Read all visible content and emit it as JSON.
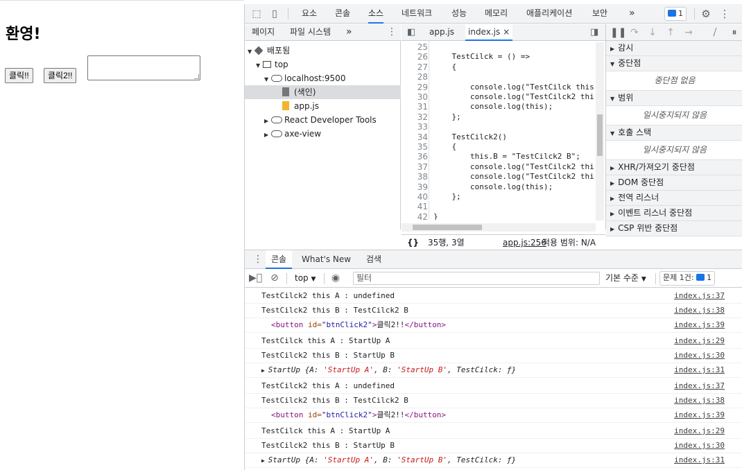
{
  "page": {
    "heading": "환영!",
    "button1": "클릭!!",
    "button2": "클릭2!!"
  },
  "devtools": {
    "main_tabs": [
      "요소",
      "콘솔",
      "소스",
      "네트워크",
      "성능",
      "메모리",
      "애플리케이션",
      "보안"
    ],
    "more_tabs": "»",
    "issue_count": "1",
    "navigator": {
      "tabs": [
        "페이지",
        "파일 시스템"
      ],
      "more": "»",
      "tree": [
        {
          "label": "배포됨"
        },
        {
          "label": "top"
        },
        {
          "label": "localhost:9500"
        },
        {
          "label": "(색인)"
        },
        {
          "label": "app.js"
        },
        {
          "label": "React Developer Tools"
        },
        {
          "label": "axe-view"
        }
      ]
    },
    "editor": {
      "tabs": [
        "app.js",
        "index.js"
      ],
      "close": "×",
      "lines": [
        {
          "n": "25",
          "code": ""
        },
        {
          "n": "26",
          "code": "    TestCilck = () =>"
        },
        {
          "n": "27",
          "code": "    {"
        },
        {
          "n": "28",
          "code": ""
        },
        {
          "n": "29",
          "code": "        console.log(\"TestCilck this"
        },
        {
          "n": "30",
          "code": "        console.log(\"TestCilck2 thi"
        },
        {
          "n": "31",
          "code": "        console.log(this);"
        },
        {
          "n": "32",
          "code": "    };"
        },
        {
          "n": "33",
          "code": ""
        },
        {
          "n": "34",
          "code": "    TestCilck2()"
        },
        {
          "n": "35",
          "code": "    {"
        },
        {
          "n": "36",
          "code": "        this.B = \"TestCilck2 B\";"
        },
        {
          "n": "37",
          "code": "        console.log(\"TestCilck2 thi"
        },
        {
          "n": "38",
          "code": "        console.log(\"TestCilck2 thi"
        },
        {
          "n": "39",
          "code": "        console.log(this);"
        },
        {
          "n": "40",
          "code": "    };"
        },
        {
          "n": "41",
          "code": ""
        },
        {
          "n": "42",
          "code": "}"
        }
      ],
      "footer_braces": "{}",
      "position": "35행, 3열",
      "source_link": "app.js:256",
      "coverage": "적용 범위: N/A"
    },
    "debugger": {
      "sections": [
        {
          "label": "감시",
          "expanded": false
        },
        {
          "label": "중단점",
          "expanded": true,
          "empty": "중단점 없음"
        },
        {
          "label": "범위",
          "expanded": true,
          "empty": "일시중지되지 않음"
        },
        {
          "label": "호출 스택",
          "expanded": true,
          "empty": "일시중지되지 않음"
        },
        {
          "label": "XHR/가져오기 중단점",
          "expanded": false
        },
        {
          "label": "DOM 중단점",
          "expanded": false
        },
        {
          "label": "전역 리스너",
          "expanded": false
        },
        {
          "label": "이벤트 리스너 중단점",
          "expanded": false
        },
        {
          "label": "CSP 위반 중단점",
          "expanded": false
        }
      ]
    },
    "drawer": {
      "tabs": [
        "콘솔",
        "What's New",
        "검색"
      ],
      "context": "top",
      "filter_placeholder": "필터",
      "level": "기본 수준",
      "issues": "문제 1건:",
      "issues_count": "1",
      "messages": [
        {
          "type": "text",
          "text": "TestCilck2 this A : undefined",
          "src": "index.js:37"
        },
        {
          "type": "text",
          "text": "TestCilck2 this B : TestCilck2 B",
          "src": "index.js:38"
        },
        {
          "type": "el",
          "open": "<button",
          "attr": " id=",
          "val": "\"btnClick2\"",
          "close": ">",
          "inner": "클릭2!!",
          "end": "</button>",
          "src": "index.js:39"
        },
        {
          "type": "text",
          "text": "TestCilck this A : StartUp A",
          "src": "index.js:29"
        },
        {
          "type": "text",
          "text": "TestCilck2 this B : StartUp B",
          "src": "index.js:30"
        },
        {
          "type": "obj",
          "name": "StartUp",
          "body_a": "{A: ",
          "va": "'StartUp A'",
          "body_b": ", B: ",
          "vb": "'StartUp B'",
          "body_c": ", TestCilck: ƒ}",
          "src": "index.js:31"
        },
        {
          "type": "text",
          "text": "TestCilck2 this A : undefined",
          "src": "index.js:37"
        },
        {
          "type": "text",
          "text": "TestCilck2 this B : TestCilck2 B",
          "src": "index.js:38"
        },
        {
          "type": "el",
          "open": "<button",
          "attr": " id=",
          "val": "\"btnClick2\"",
          "close": ">",
          "inner": "클릭2!!",
          "end": "</button>",
          "src": "index.js:39"
        },
        {
          "type": "text",
          "text": "TestCilck this A : StartUp A",
          "src": "index.js:29"
        },
        {
          "type": "text",
          "text": "TestCilck2 this B : StartUp B",
          "src": "index.js:30"
        },
        {
          "type": "obj",
          "name": "StartUp",
          "body_a": "{A: ",
          "va": "'StartUp A'",
          "body_b": ", B: ",
          "vb": "'StartUp B'",
          "body_c": ", TestCilck: ƒ}",
          "src": "index.js:31"
        }
      ]
    }
  }
}
